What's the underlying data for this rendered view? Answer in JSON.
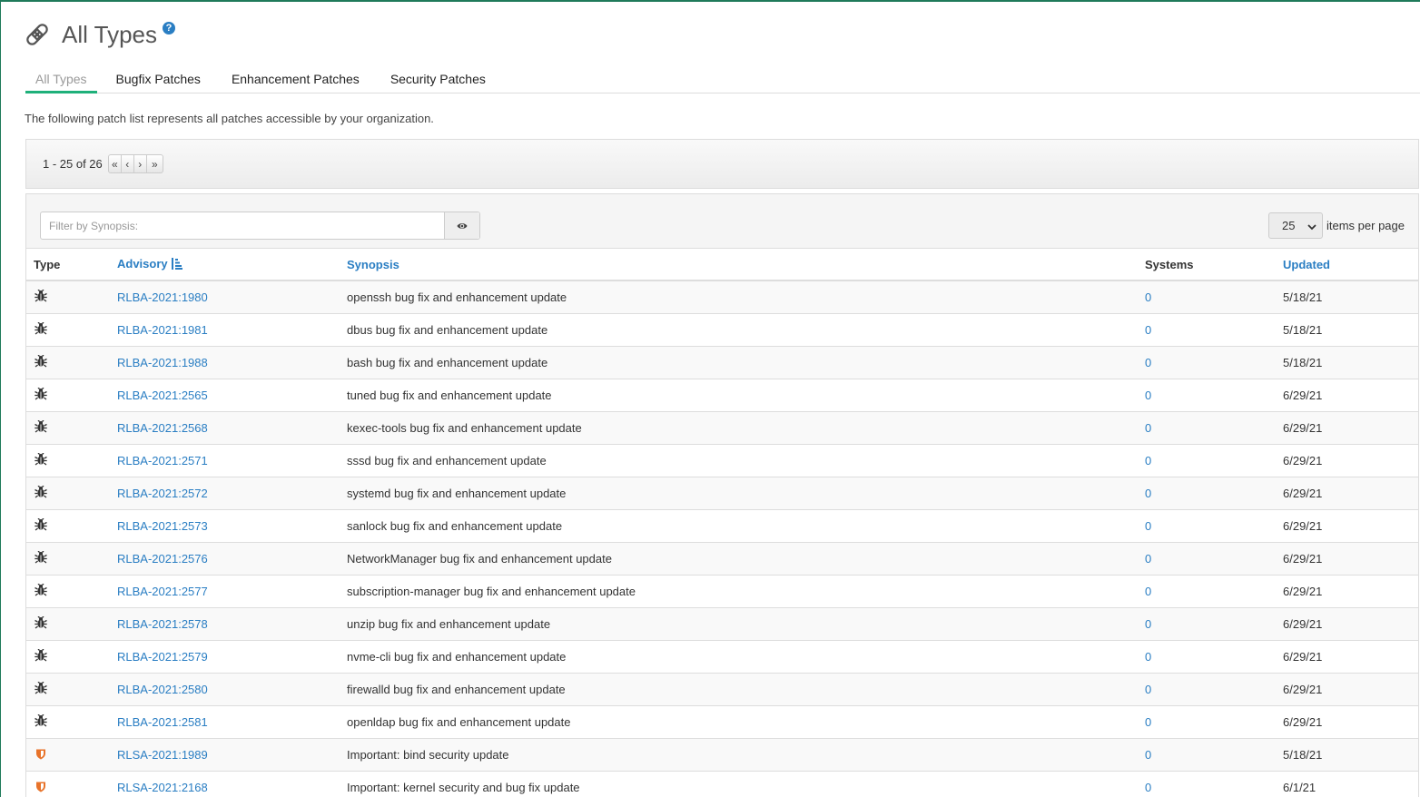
{
  "page": {
    "title": "All Types",
    "help_symbol": "?",
    "description": "The following patch list represents all patches accessible by your organization."
  },
  "tabs": [
    {
      "label": "All Types",
      "active": true
    },
    {
      "label": "Bugfix Patches",
      "active": false
    },
    {
      "label": "Enhancement Patches",
      "active": false
    },
    {
      "label": "Security Patches",
      "active": false
    }
  ],
  "pager": {
    "count_text": "1 - 25 of 26",
    "buttons": [
      "«",
      "‹",
      "›",
      "»"
    ]
  },
  "filter": {
    "placeholder": "Filter by Synopsis:",
    "button_icon": "eye-icon"
  },
  "per_page": {
    "value": "25",
    "label": "items per page"
  },
  "table": {
    "headers": {
      "type": "Type",
      "advisory": "Advisory",
      "synopsis": "Synopsis",
      "systems": "Systems",
      "updated": "Updated"
    },
    "rows": [
      {
        "type": "bug",
        "advisory": "RLBA-2021:1980",
        "synopsis": "openssh bug fix and enhancement update",
        "systems": "0",
        "updated": "5/18/21"
      },
      {
        "type": "bug",
        "advisory": "RLBA-2021:1981",
        "synopsis": "dbus bug fix and enhancement update",
        "systems": "0",
        "updated": "5/18/21"
      },
      {
        "type": "bug",
        "advisory": "RLBA-2021:1988",
        "synopsis": "bash bug fix and enhancement update",
        "systems": "0",
        "updated": "5/18/21"
      },
      {
        "type": "bug",
        "advisory": "RLBA-2021:2565",
        "synopsis": "tuned bug fix and enhancement update",
        "systems": "0",
        "updated": "6/29/21"
      },
      {
        "type": "bug",
        "advisory": "RLBA-2021:2568",
        "synopsis": "kexec-tools bug fix and enhancement update",
        "systems": "0",
        "updated": "6/29/21"
      },
      {
        "type": "bug",
        "advisory": "RLBA-2021:2571",
        "synopsis": "sssd bug fix and enhancement update",
        "systems": "0",
        "updated": "6/29/21"
      },
      {
        "type": "bug",
        "advisory": "RLBA-2021:2572",
        "synopsis": "systemd bug fix and enhancement update",
        "systems": "0",
        "updated": "6/29/21"
      },
      {
        "type": "bug",
        "advisory": "RLBA-2021:2573",
        "synopsis": "sanlock bug fix and enhancement update",
        "systems": "0",
        "updated": "6/29/21"
      },
      {
        "type": "bug",
        "advisory": "RLBA-2021:2576",
        "synopsis": "NetworkManager bug fix and enhancement update",
        "systems": "0",
        "updated": "6/29/21"
      },
      {
        "type": "bug",
        "advisory": "RLBA-2021:2577",
        "synopsis": "subscription-manager bug fix and enhancement update",
        "systems": "0",
        "updated": "6/29/21"
      },
      {
        "type": "bug",
        "advisory": "RLBA-2021:2578",
        "synopsis": "unzip bug fix and enhancement update",
        "systems": "0",
        "updated": "6/29/21"
      },
      {
        "type": "bug",
        "advisory": "RLBA-2021:2579",
        "synopsis": "nvme-cli bug fix and enhancement update",
        "systems": "0",
        "updated": "6/29/21"
      },
      {
        "type": "bug",
        "advisory": "RLBA-2021:2580",
        "synopsis": "firewalld bug fix and enhancement update",
        "systems": "0",
        "updated": "6/29/21"
      },
      {
        "type": "bug",
        "advisory": "RLBA-2021:2581",
        "synopsis": "openldap bug fix and enhancement update",
        "systems": "0",
        "updated": "6/29/21"
      },
      {
        "type": "security",
        "advisory": "RLSA-2021:1989",
        "synopsis": "Important: bind security update",
        "systems": "0",
        "updated": "5/18/21"
      },
      {
        "type": "security",
        "advisory": "RLSA-2021:2168",
        "synopsis": "Important: kernel security and bug fix update",
        "systems": "0",
        "updated": "6/1/21"
      }
    ]
  },
  "colors": {
    "link": "#2a7ec3",
    "active_tab": "#1fb07a",
    "security_icon": "#e8732a",
    "bug_icon": "#333333",
    "accent_border": "#1f7a5a"
  }
}
